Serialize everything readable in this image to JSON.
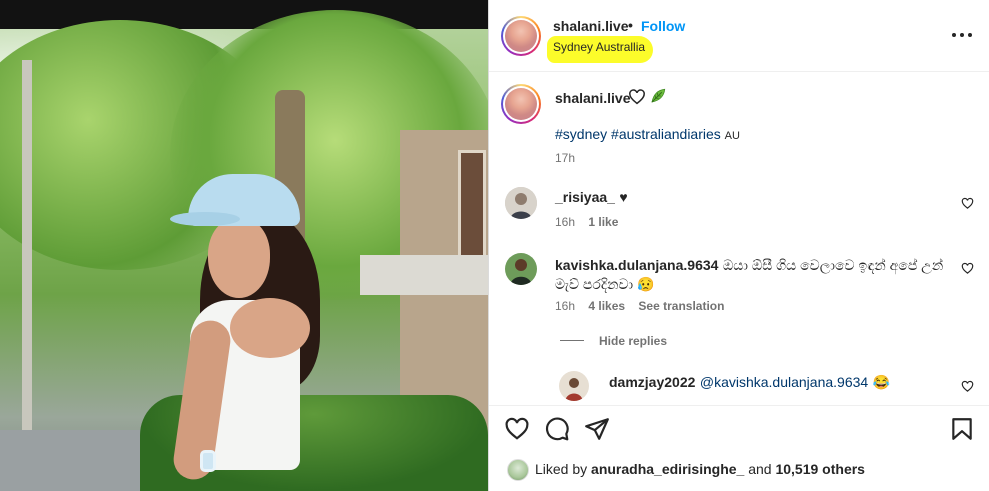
{
  "post": {
    "author": "shalani.live",
    "separator": "•",
    "follow_label": "Follow",
    "location": "Sydney Australlia"
  },
  "caption": {
    "author": "shalani.live",
    "tags": [
      "#sydney",
      "#australiandiaries"
    ],
    "tag_suffix": "AU",
    "time": "17h"
  },
  "comments": [
    {
      "user": "_risiyaa_",
      "text": "♥",
      "time": "16h",
      "likes": "1 like"
    },
    {
      "user": "kavishka.dulanjana.9634",
      "text": "ඔයා ඕසී ගිය වෙලාවෙ ඉඳන් අපේ උන් මැව් පරදිනවා 😥",
      "time": "16h",
      "likes": "4 likes",
      "translate": "See translation"
    }
  ],
  "hide_replies": "Hide replies",
  "reply": {
    "user": "damzjay2022",
    "mention": "@kavishka.dulanjana.9634",
    "emoji": "😂"
  },
  "likes": {
    "prefix": "Liked by",
    "user": "anuradha_edirisinghe_",
    "middle": "and",
    "count": "10,519 others"
  },
  "colors": {
    "follow": "#0095f6",
    "hashtag": "#00376b",
    "location_highlight": "#fcfc2a",
    "muted": "#737373"
  },
  "icons": [
    "more-icon",
    "heart-icon",
    "comment-icon",
    "share-icon",
    "bookmark-icon",
    "leaf-icon"
  ]
}
